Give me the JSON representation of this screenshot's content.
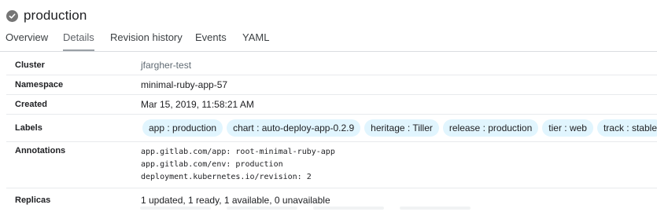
{
  "header": {
    "status_icon": "check-circle-icon",
    "title": "production"
  },
  "tabs": [
    {
      "label": "Overview"
    },
    {
      "label": "Details"
    },
    {
      "label": "Revision history"
    },
    {
      "label": "Events"
    },
    {
      "label": "YAML"
    }
  ],
  "active_tab": "Details",
  "details": {
    "cluster": {
      "label": "Cluster",
      "value": "jfargher-test"
    },
    "namespace": {
      "label": "Namespace",
      "value": "minimal-ruby-app-57"
    },
    "created": {
      "label": "Created",
      "value": "Mar 15, 2019, 11:58:21 AM"
    },
    "labels": {
      "label": "Labels",
      "chips": [
        "app : production",
        "chart : auto-deploy-app-0.2.9",
        "heritage : Tiller",
        "release : production",
        "tier : web",
        "track : stable"
      ]
    },
    "annotations": {
      "label": "Annotations",
      "lines": [
        "app.gitlab.com/app: root-minimal-ruby-app",
        "app.gitlab.com/env: production",
        "deployment.kubernetes.io/revision: 2"
      ]
    },
    "replicas": {
      "label": "Replicas",
      "value": "1 updated, 1 ready, 1 available, 0 unavailable"
    }
  },
  "colors": {
    "chip_bg": "#e1f5fe",
    "link": "#5f6a73",
    "status_icon": "#757575",
    "divider": "#dadce0"
  }
}
